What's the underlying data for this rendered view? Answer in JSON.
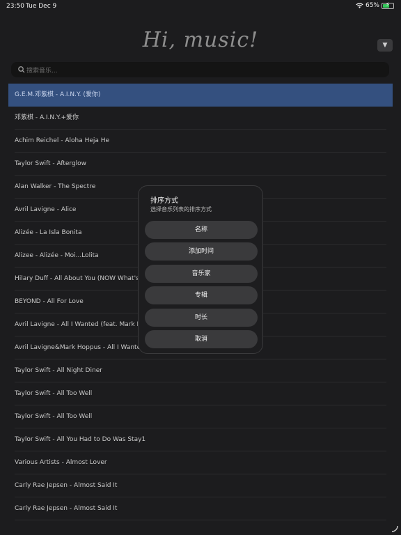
{
  "status_bar": {
    "time": "23:50",
    "date": "Tue Dec 9",
    "battery": "65%",
    "battery_level": 0.65
  },
  "app": {
    "title": "Hi, music!",
    "sort_button": "▼"
  },
  "search": {
    "placeholder": "搜索音乐..."
  },
  "songs": [
    "G.E.M.邓紫棋 - A.I.N.Y. (爱你)",
    "邓紫棋 - A.I.N.Y.+爱你",
    "Achim Reichel - Aloha Heja He",
    "Taylor Swift - Afterglow",
    "Alan Walker - The Spectre",
    "Avril Lavigne - Alice",
    "Alizée - La Isla Bonita",
    "Alizee - Alizée - Moi...Lolita",
    "Hilary Duff - All About You (NOW What's New",
    "BEYOND - All For Love",
    "Avril Lavigne - All I Wanted (feat. Mark Hoppus)",
    "Avril Lavigne&Mark Hoppus - All I Wanted (feat",
    "Taylor Swift - All Night Diner",
    "Taylor Swift - All Too Well",
    "Taylor Swift - All Too Well",
    "Taylor Swift - All You Had to Do Was Stay1",
    "Various Artists - Almost Lover",
    "Carly Rae Jepsen - Almost Said It",
    "Carly Rae Jepsen - Almost Said It"
  ],
  "selected_index": 0,
  "sort_sheet": {
    "title": "排序方式",
    "subtitle": "选择音乐列表的排序方式",
    "options": [
      "名称",
      "添加时间",
      "音乐家",
      "专辑",
      "时长",
      "取消"
    ]
  },
  "colors": {
    "background": "#1c1c1e",
    "selected_row": "#34507f",
    "button": "#3a3a3c"
  }
}
